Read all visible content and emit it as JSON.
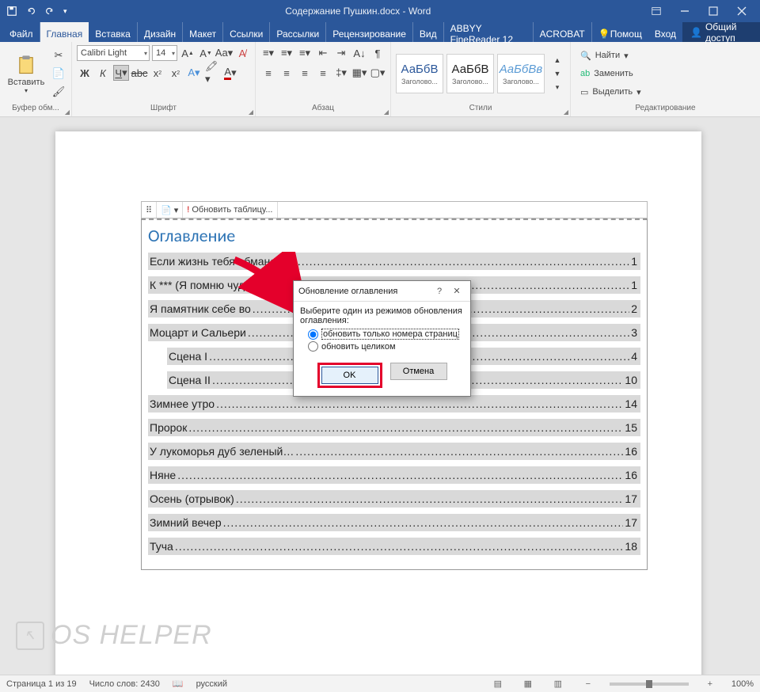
{
  "titlebar": {
    "title": "Содержание Пушкин.docx - Word"
  },
  "tabs": {
    "file": "Файл",
    "home": "Главная",
    "insert": "Вставка",
    "design": "Дизайн",
    "layout": "Макет",
    "references": "Ссылки",
    "mailings": "Рассылки",
    "review": "Рецензирование",
    "view": "Вид",
    "abbyy": "ABBYY FineReader 12",
    "acrobat": "ACROBAT",
    "help": "Помощ",
    "login": "Вход",
    "share": "Общий доступ"
  },
  "ribbon": {
    "clipboard": {
      "label": "Буфер обм...",
      "paste": "Вставить"
    },
    "font": {
      "label": "Шрифт",
      "name": "Calibri Light",
      "size": "14"
    },
    "paragraph": {
      "label": "Абзац"
    },
    "styles": {
      "label": "Стили",
      "s1": {
        "preview": "АаБбВ",
        "name": "Заголово..."
      },
      "s2": {
        "preview": "АаБбВ",
        "name": "Заголово..."
      },
      "s3": {
        "preview": "АаБбВв",
        "name": "Заголово..."
      }
    },
    "editing": {
      "label": "Редактирование",
      "find": "Найти",
      "replace": "Заменить",
      "select": "Выделить"
    }
  },
  "toc": {
    "toolbar_update": "Обновить таблицу...",
    "title": "Оглавление",
    "items": [
      {
        "text": "Если жизнь тебя обманет…",
        "page": "1",
        "indent": false
      },
      {
        "text": "К *** (Я помню чудно",
        "page": "1",
        "indent": false
      },
      {
        "text": "Я памятник себе во",
        "page": "2",
        "indent": false
      },
      {
        "text": "Моцарт и Сальери",
        "page": "3",
        "indent": false
      },
      {
        "text": "Сцена I",
        "page": "4",
        "indent": true
      },
      {
        "text": "Сцена II",
        "page": "10",
        "indent": true
      },
      {
        "text": "Зимнее утро",
        "page": "14",
        "indent": false
      },
      {
        "text": "Пророк",
        "page": "15",
        "indent": false
      },
      {
        "text": "У лукоморья дуб зеленый…",
        "page": "16",
        "indent": false
      },
      {
        "text": "Няне",
        "page": "16",
        "indent": false
      },
      {
        "text": "Осень (отрывок)",
        "page": "17",
        "indent": false
      },
      {
        "text": "Зимний вечер",
        "page": "17",
        "indent": false
      },
      {
        "text": "Туча",
        "page": "18",
        "indent": false
      }
    ]
  },
  "dialog": {
    "title": "Обновление оглавления",
    "prompt": "Выберите один из режимов обновления оглавления:",
    "opt1": "обновить только номера страниц",
    "opt2": "обновить целиком",
    "ok": "OK",
    "cancel": "Отмена"
  },
  "status": {
    "page": "Страница 1 из 19",
    "words": "Число слов: 2430",
    "lang": "русский",
    "zoom": "100%"
  },
  "watermark": "OS HELPER"
}
